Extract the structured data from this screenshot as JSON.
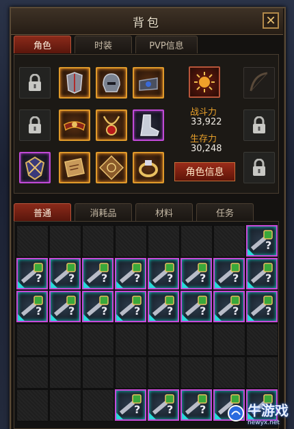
{
  "window": {
    "title": "背包",
    "close_glyph": "✕"
  },
  "character_tabs": [
    {
      "label": "角色",
      "active": true
    },
    {
      "label": "时装",
      "active": false
    },
    {
      "label": "PVP信息",
      "active": false
    }
  ],
  "stats": {
    "combat_label": "战斗力",
    "combat_value": "33,922",
    "survival_label": "生存力",
    "survival_value": "30,248"
  },
  "character_info_button": "角色信息",
  "equipment": {
    "left_locked_slots": 2,
    "right_locked_slots": 2,
    "equipped": [
      {
        "name": "chest-armor-icon",
        "rarity": "gold"
      },
      {
        "name": "helmet-icon",
        "rarity": "gold"
      },
      {
        "name": "gauntlet-icon",
        "rarity": "gold"
      },
      {
        "name": "belt-icon",
        "rarity": "gold"
      },
      {
        "name": "necklace-icon",
        "rarity": "gold"
      },
      {
        "name": "boots-icon",
        "rarity": "purple"
      },
      {
        "name": "crest-icon",
        "rarity": "purple"
      },
      {
        "name": "scroll-icon",
        "rarity": "gold"
      },
      {
        "name": "rune-tablet-icon",
        "rarity": "gold"
      },
      {
        "name": "ring-icon",
        "rarity": "gold"
      }
    ],
    "emblem_icon": "sun-emblem-icon",
    "bow_icon": "bow-icon"
  },
  "inventory_tabs": [
    {
      "label": "普通",
      "active": true
    },
    {
      "label": "消耗品",
      "active": false
    },
    {
      "label": "材料",
      "active": false
    },
    {
      "label": "任务",
      "active": false
    }
  ],
  "inventory": {
    "columns": 8,
    "rows": 6,
    "item_icon": "unidentified-key-icon",
    "filled_cells": [
      [
        0,
        7
      ],
      [
        1,
        0
      ],
      [
        1,
        1
      ],
      [
        1,
        2
      ],
      [
        1,
        3
      ],
      [
        1,
        4
      ],
      [
        1,
        5
      ],
      [
        1,
        6
      ],
      [
        1,
        7
      ],
      [
        2,
        0
      ],
      [
        2,
        1
      ],
      [
        2,
        2
      ],
      [
        2,
        3
      ],
      [
        2,
        4
      ],
      [
        2,
        5
      ],
      [
        2,
        6
      ],
      [
        2,
        7
      ],
      [
        5,
        3
      ],
      [
        5,
        4
      ],
      [
        5,
        5
      ],
      [
        5,
        6
      ],
      [
        5,
        7
      ]
    ]
  },
  "watermark": {
    "main": "牛游戏",
    "sub": "newyx.net"
  },
  "colors": {
    "gold_rarity": "#e09a2a",
    "purple_rarity": "#c24ad8",
    "stat_label": "#e8a02a",
    "active_tab": "#8a2a1a"
  }
}
